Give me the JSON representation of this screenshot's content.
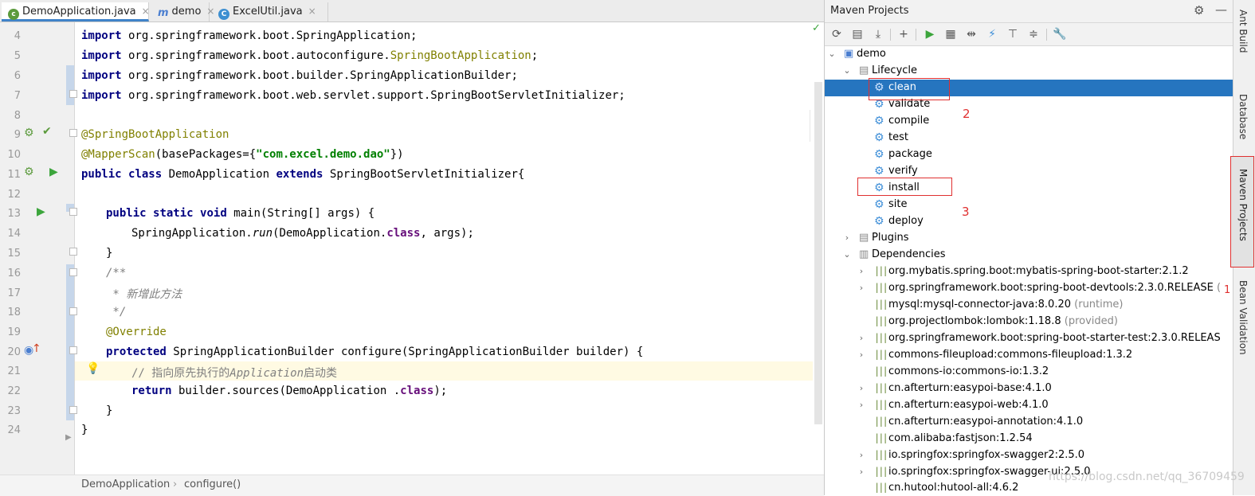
{
  "tabs": [
    {
      "label": "DemoApplication.java",
      "icon": "spring-class-icon",
      "active": true
    },
    {
      "label": "demo",
      "icon": "maven-m-icon",
      "active": false
    },
    {
      "label": "ExcelUtil.java",
      "icon": "class-c-icon",
      "active": false
    }
  ],
  "tab_close": "×",
  "editor": {
    "line_numbers": [
      "4",
      "5",
      "6",
      "7",
      "8",
      "9",
      "10",
      "11",
      "12",
      "13",
      "14",
      "15",
      "16",
      "17",
      "18",
      "19",
      "20",
      "21",
      "22",
      "23",
      "24"
    ],
    "lines": {
      "l4": {
        "kw": "import",
        "rest": " org.springframework.boot.SpringApplication;"
      },
      "l5": {
        "kw": "import",
        "rest": " org.springframework.boot.autoconfigure.",
        "ann": "SpringBootApplication",
        "end": ";"
      },
      "l6": {
        "kw": "import",
        "rest": " org.springframework.boot.builder.SpringApplicationBuilder;"
      },
      "l7": {
        "kw": "import",
        "rest": " org.springframework.boot.web.servlet.support.SpringBootServletInitializer;"
      },
      "l9": {
        "ann": "@SpringBootApplication"
      },
      "l10": {
        "ann": "@MapperScan",
        "a": "(basePackages={",
        "str": "\"com.excel.demo.dao\"",
        "b": "})"
      },
      "l11": {
        "kw1": "public",
        "kw2": "class",
        "name": " DemoApplication ",
        "kw3": "extends",
        "rest": " SpringBootServletInitializer{"
      },
      "l13": {
        "kw1": "public",
        "kw2": "static",
        "kw3": "void",
        "rest": " main(String[] args) {"
      },
      "l14": {
        "a": "SpringApplication.",
        "it": "run",
        "b": "(DemoApplication.",
        "fld": "class",
        "c": ", args);"
      },
      "l15": {
        "text": "}"
      },
      "l16": {
        "text": "/**"
      },
      "l17": {
        "text": " * 新增此方法"
      },
      "l18": {
        "text": " */"
      },
      "l19": {
        "ann": "@Override"
      },
      "l20": {
        "kw": "protected",
        "rest": " SpringApplicationBuilder configure(SpringApplicationBuilder builder) {"
      },
      "l21": {
        "a": "// 指向原先执行的",
        "it": "Application",
        "b": "启动类"
      },
      "l22": {
        "kw": "return",
        "rest": " builder.sources(DemoApplication .",
        "fld": "class",
        "end": ");"
      },
      "l23": {
        "text": "}"
      },
      "l24": {
        "text": "}"
      }
    }
  },
  "breadcrumb": {
    "class": "DemoApplication",
    "sep": "›",
    "method": "configure()"
  },
  "maven": {
    "title": "Maven Projects",
    "root": "demo",
    "lifecycle": "Lifecycle",
    "phases": [
      "clean",
      "validate",
      "compile",
      "test",
      "package",
      "verify",
      "install",
      "site",
      "deploy"
    ],
    "selected_phase": "clean",
    "plugins": "Plugins",
    "dependencies_label": "Dependencies",
    "dependencies": [
      {
        "name": "org.mybatis.spring.boot:mybatis-spring-boot-starter:2.1.2",
        "scope": "",
        "expandable": true
      },
      {
        "name": "org.springframework.boot:spring-boot-devtools:2.3.0.RELEASE",
        "scope": "(",
        "expandable": true
      },
      {
        "name": "mysql:mysql-connector-java:8.0.20",
        "scope": "(runtime)",
        "expandable": false
      },
      {
        "name": "org.projectlombok:lombok:1.18.8",
        "scope": "(provided)",
        "expandable": false
      },
      {
        "name": "org.springframework.boot:spring-boot-starter-test:2.3.0.RELEAS",
        "scope": "",
        "expandable": true
      },
      {
        "name": "commons-fileupload:commons-fileupload:1.3.2",
        "scope": "",
        "expandable": true
      },
      {
        "name": "commons-io:commons-io:1.3.2",
        "scope": "",
        "expandable": false
      },
      {
        "name": "cn.afterturn:easypoi-base:4.1.0",
        "scope": "",
        "expandable": true
      },
      {
        "name": "cn.afterturn:easypoi-web:4.1.0",
        "scope": "",
        "expandable": true
      },
      {
        "name": "cn.afterturn:easypoi-annotation:4.1.0",
        "scope": "",
        "expandable": false
      },
      {
        "name": "com.alibaba:fastjson:1.2.54",
        "scope": "",
        "expandable": false
      },
      {
        "name": "io.springfox:springfox-swagger2:2.5.0",
        "scope": "",
        "expandable": true
      },
      {
        "name": "io.springfox:springfox-swagger-ui:2.5.0",
        "scope": "",
        "expandable": true
      },
      {
        "name": "cn.hutool:hutool-all:4.6.2",
        "scope": "",
        "expandable": false
      }
    ],
    "annotations": {
      "num2": "2",
      "num3": "3",
      "num1": "1"
    }
  },
  "side_tabs": [
    "Ant Build",
    "Database",
    "Maven Projects",
    "Bean Validation"
  ],
  "watermark": "https://blog.csdn.net/qq_36709459",
  "colors": {
    "selection": "#2675bf",
    "annotation_red": "#e03030",
    "keyword": "#000080",
    "string": "#008000"
  }
}
